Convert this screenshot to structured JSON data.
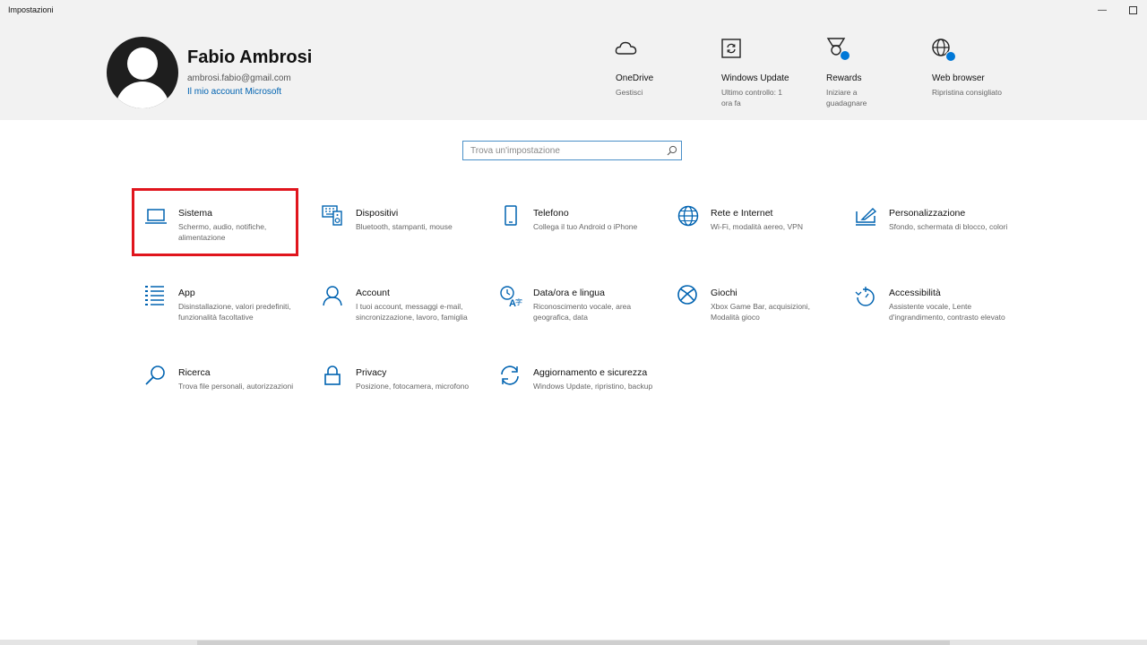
{
  "window": {
    "title": "Impostazioni",
    "minimize_label": "—"
  },
  "profile": {
    "name": "Fabio Ambrosi",
    "email": "ambrosi.fabio@gmail.com",
    "account_link": "Il mio account Microsoft"
  },
  "quick_links": [
    {
      "title": "OneDrive",
      "subtitle": "Gestisci",
      "icon": "cloud-icon"
    },
    {
      "title": "Windows Update",
      "subtitle": "Ultimo controllo: 1 ora fa",
      "icon": "windows-update-icon"
    },
    {
      "title": "Rewards",
      "subtitle": "Iniziare a guadagnare",
      "icon": "rewards-medal-icon"
    },
    {
      "title": "Web browser",
      "subtitle": "Ripristina consigliato",
      "icon": "globe-icon"
    }
  ],
  "search": {
    "placeholder": "Trova un'impostazione"
  },
  "categories": [
    {
      "title": "Sistema",
      "desc": "Schermo, audio, notifiche, alimentazione",
      "icon": "laptop-icon"
    },
    {
      "title": "Dispositivi",
      "desc": "Bluetooth, stampanti, mouse",
      "icon": "devices-icon"
    },
    {
      "title": "Telefono",
      "desc": "Collega il tuo Android o iPhone",
      "icon": "phone-icon"
    },
    {
      "title": "Rete e Internet",
      "desc": "Wi-Fi, modalità aereo, VPN",
      "icon": "globe-icon"
    },
    {
      "title": "Personalizzazione",
      "desc": "Sfondo, schermata di blocco, colori",
      "icon": "personalization-icon"
    },
    {
      "title": "App",
      "desc": "Disinstallazione, valori predefiniti, funzionalità facoltative",
      "icon": "apps-list-icon"
    },
    {
      "title": "Account",
      "desc": "I tuoi account, messaggi e-mail, sincronizzazione, lavoro, famiglia",
      "icon": "person-icon"
    },
    {
      "title": "Data/ora e lingua",
      "desc": "Riconoscimento vocale, area geografica, data",
      "icon": "time-language-icon"
    },
    {
      "title": "Giochi",
      "desc": "Xbox Game Bar, acquisizioni, Modalità gioco",
      "icon": "xbox-icon"
    },
    {
      "title": "Accessibilità",
      "desc": "Assistente vocale, Lente d'ingrandimento, contrasto elevato",
      "icon": "accessibility-timer-icon"
    },
    {
      "title": "Ricerca",
      "desc": "Trova file personali, autorizzazioni",
      "icon": "search-icon"
    },
    {
      "title": "Privacy",
      "desc": "Posizione, fotocamera, microfono",
      "icon": "lock-icon"
    },
    {
      "title": "Aggiornamento e sicurezza",
      "desc": "Windows Update, ripristino, backup",
      "icon": "sync-icon"
    }
  ],
  "colors": {
    "accent": "#0063b1",
    "highlight_box": "#e0151d",
    "header_bg": "#f2f2f2"
  }
}
